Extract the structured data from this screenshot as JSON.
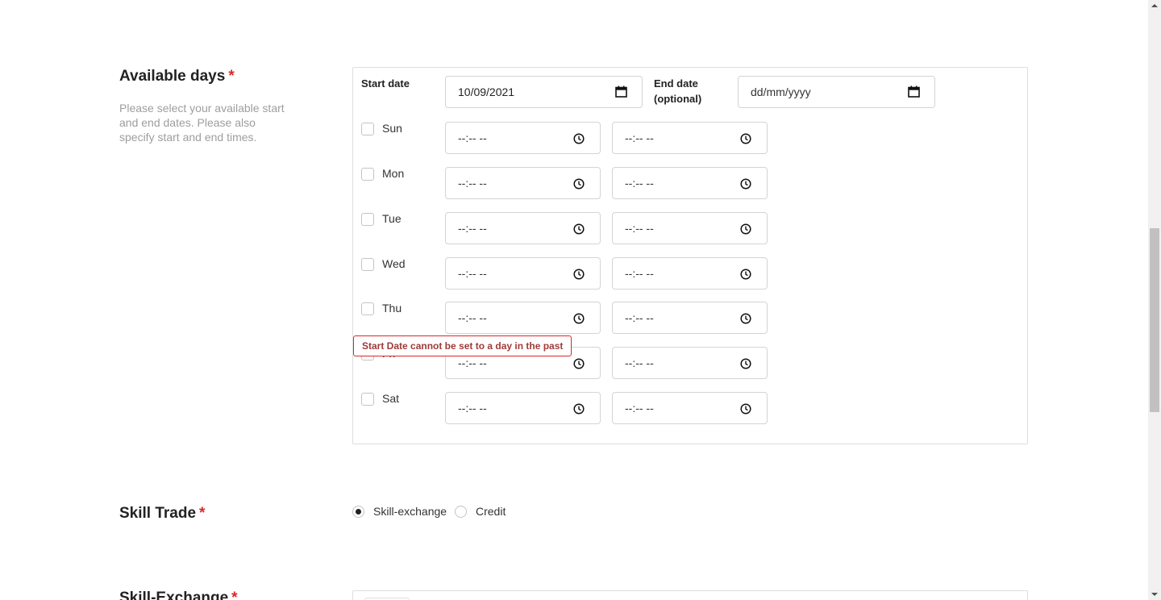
{
  "available_days": {
    "title": "Available days",
    "required_mark": "*",
    "description": "Please select your available start and end dates. Please also specify start and end times.",
    "start_date_label": "Start date",
    "start_date_value": "10/09/2021",
    "end_date_label_line1": "End date",
    "end_date_label_line2": "(optional)",
    "end_date_placeholder": "dd/mm/yyyy",
    "time_placeholder": "--:-- --",
    "days": [
      {
        "label": "Sun",
        "checked": false
      },
      {
        "label": "Mon",
        "checked": false
      },
      {
        "label": "Tue",
        "checked": false
      },
      {
        "label": "Wed",
        "checked": false
      },
      {
        "label": "Thu",
        "checked": false
      },
      {
        "label": "Fri",
        "checked": false
      },
      {
        "label": "Sat",
        "checked": false
      }
    ],
    "error_message": "Start Date cannot be set to a day in the past"
  },
  "skill_trade": {
    "title": "Skill Trade",
    "required_mark": "*",
    "options": [
      {
        "label": "Skill-exchange",
        "checked": true
      },
      {
        "label": "Credit",
        "checked": false
      }
    ]
  },
  "skill_exchange": {
    "title": "Skill-Exchange",
    "required_mark": "*"
  },
  "icons": {
    "calendar": "calendar-icon",
    "clock": "clock-icon"
  },
  "colors": {
    "required": "#db2828",
    "error_text": "#9f3a38",
    "description": "#9e9e9e"
  }
}
